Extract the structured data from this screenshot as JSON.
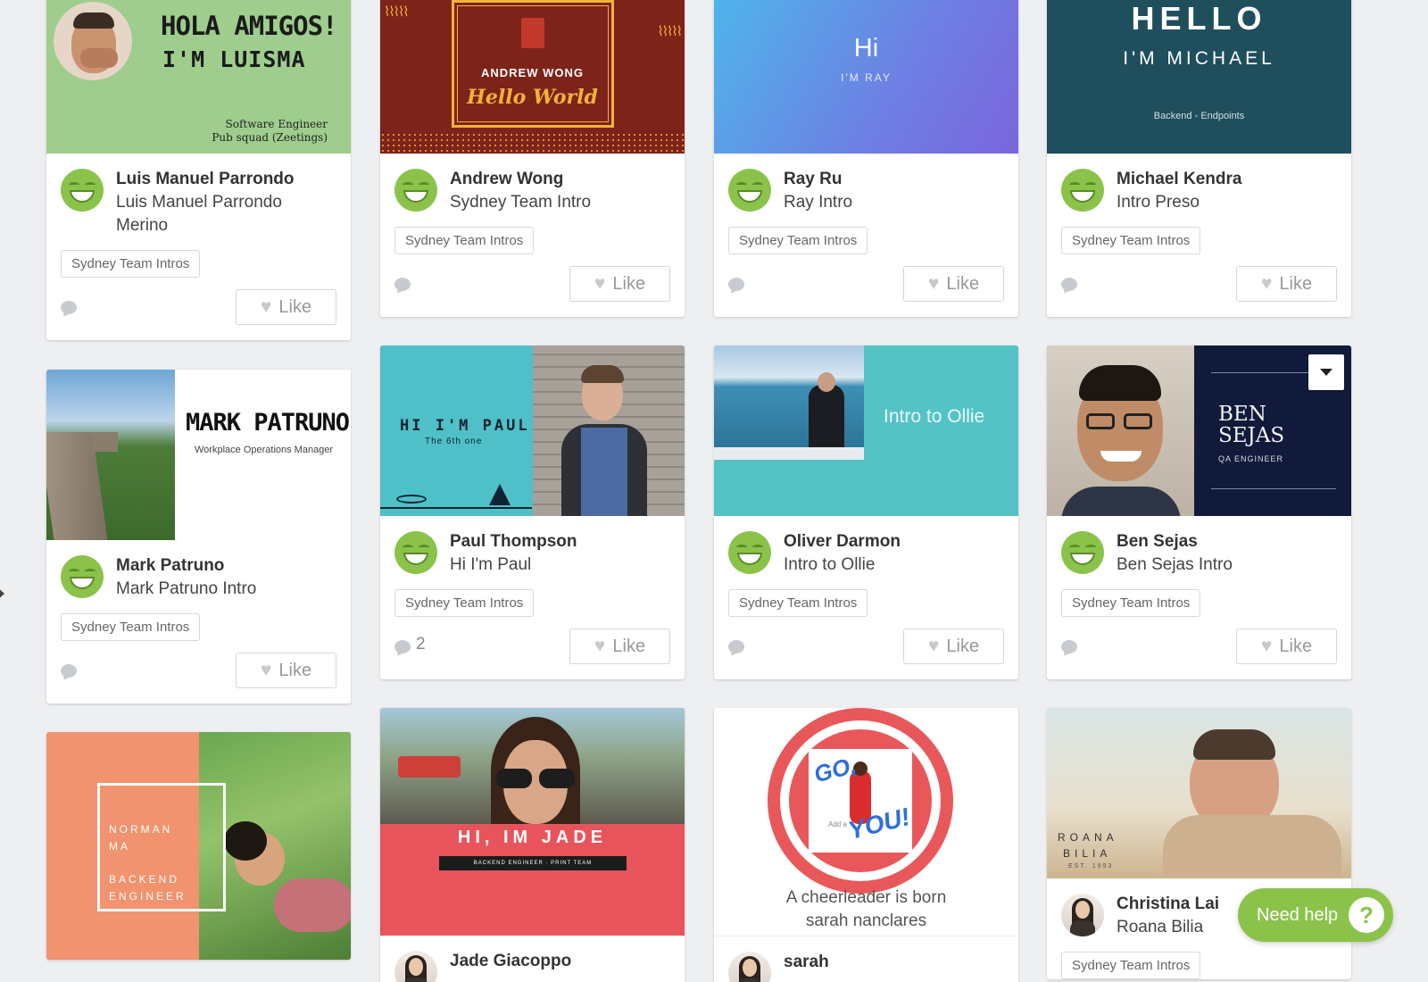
{
  "cards": [
    {
      "author": "Luis Manuel Parrondo",
      "title": "Luis Manuel Parrondo Merino",
      "tag": "Sydney Team Intros",
      "like_label": "Like",
      "comments": "",
      "thumb": {
        "line1": "HOLA AMIGOS!",
        "line2": "I'M LUISMA",
        "sub1": "Software Engineer",
        "sub2": "Pub squad (Zeetings)"
      }
    },
    {
      "author": "Andrew Wong",
      "title": "Sydney Team Intro",
      "tag": "Sydney Team Intros",
      "like_label": "Like",
      "comments": "",
      "thumb": {
        "name": "ANDREW WONG",
        "script": "Hello World"
      }
    },
    {
      "author": "Ray Ru",
      "title": "Ray Intro",
      "tag": "Sydney Team Intros",
      "like_label": "Like",
      "comments": "",
      "thumb": {
        "hi": "Hi",
        "sub": "I'M RAY"
      }
    },
    {
      "author": "Michael Kendra",
      "title": "Intro Preso",
      "tag": "Sydney Team Intros",
      "like_label": "Like",
      "comments": "",
      "thumb": {
        "hello": "HELLO",
        "im": "I'M MICHAEL",
        "sub": "Backend - Endpoints"
      }
    },
    {
      "author": "Mark Patruno",
      "title": "Mark Patruno Intro",
      "tag": "Sydney Team Intros",
      "like_label": "Like",
      "comments": "",
      "thumb": {
        "name": "MARK PATRUNO",
        "sub": "Workplace Operations Manager"
      }
    },
    {
      "author": "Paul Thompson",
      "title": "Hi I'm Paul",
      "tag": "Sydney Team Intros",
      "like_label": "Like",
      "comments": "2",
      "thumb": {
        "hi": "HI I'M PAUL",
        "sub": "The 6th one"
      }
    },
    {
      "author": "Oliver Darmon",
      "title": "Intro to Ollie",
      "tag": "Sydney Team Intros",
      "like_label": "Like",
      "comments": "",
      "thumb": {
        "text": "Intro to Ollie"
      }
    },
    {
      "author": "Ben Sejas",
      "title": "Ben Sejas Intro",
      "tag": "Sydney Team Intros",
      "like_label": "Like",
      "comments": "",
      "thumb": {
        "name1": "BEN",
        "name2": "SEJAS",
        "sub": "QA ENGINEER"
      }
    },
    {
      "thumb": {
        "l1": "NORMAN",
        "l2": "MA",
        "l3": "BACKEND",
        "l4": "ENGINEER"
      }
    },
    {
      "author": "Jade Giacoppo",
      "thumb": {
        "title": "HI, IM JADE",
        "sub": "BACKEND ENGINEER · PRINT TEAM"
      }
    },
    {
      "author": "sarah",
      "thumb": {
        "go": "GO,",
        "you": "YOU!",
        "small": "Add a",
        "cap1": "A cheerleader is born",
        "cap2": "sarah nanclares"
      }
    },
    {
      "author": "Christina Lai",
      "title": "Roana Bilia",
      "tag": "Sydney Team Intros",
      "thumb": {
        "l1": "ROANA",
        "l2": "BILIA",
        "l3": "EST. 1993"
      }
    }
  ],
  "help": {
    "label": "Need help",
    "icon": "?"
  }
}
